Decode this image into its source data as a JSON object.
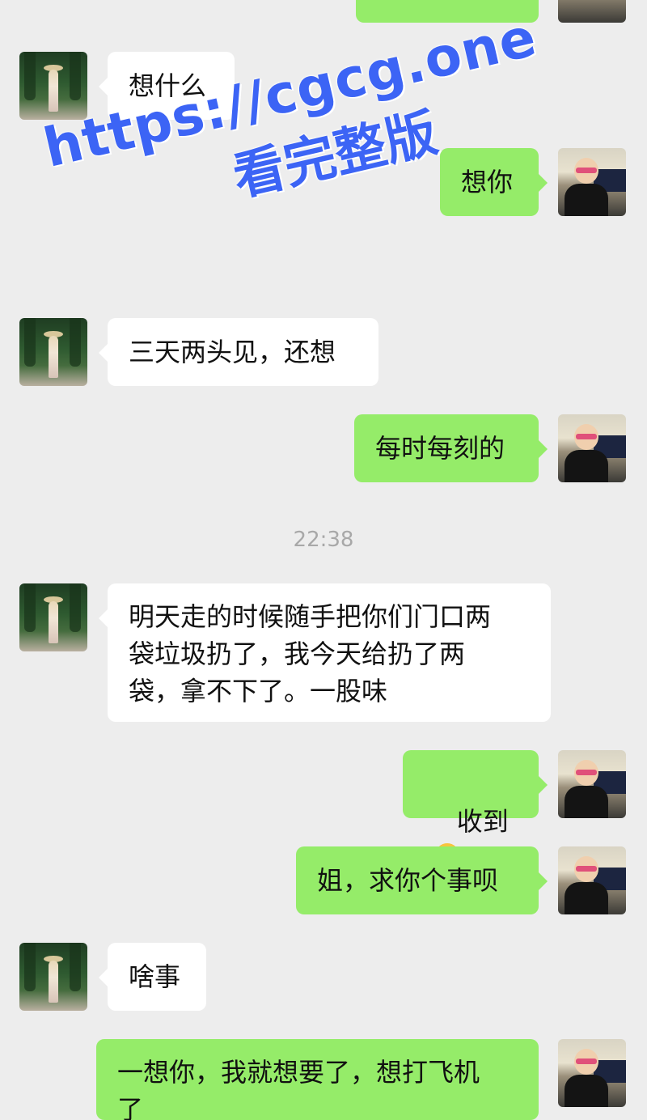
{
  "watermark": {
    "url": "https://cgcg.one",
    "caption": "看完整版"
  },
  "timestamp": "22:38",
  "messages": [
    {
      "side": "in",
      "text": "想什么"
    },
    {
      "side": "out",
      "text": "想你"
    },
    {
      "side": "in",
      "text": "三天两头见，还想"
    },
    {
      "side": "out",
      "text": "每时每刻的"
    },
    {
      "side": "in",
      "text": "明天走的时候随手把你们门口两\n袋垃圾扔了，我今天给扔了两\n袋，拿不下了。一股味"
    },
    {
      "side": "out",
      "text": "收到",
      "emoji": "saluting-face-pointing-icon"
    },
    {
      "side": "out",
      "text": "姐，求你个事呗"
    },
    {
      "side": "in",
      "text": "啥事"
    },
    {
      "side": "out",
      "text": "一想你，我就想要了，想打飞机\n了"
    }
  ],
  "avatars": {
    "incoming": "forest-photo-avatar",
    "outgoing": "selfie-photo-avatar"
  },
  "colors": {
    "background": "#ededed",
    "outgoing_bubble": "#95ec69",
    "incoming_bubble": "#ffffff",
    "watermark": "#3c64f5",
    "timestamp": "#a8a8a8"
  }
}
